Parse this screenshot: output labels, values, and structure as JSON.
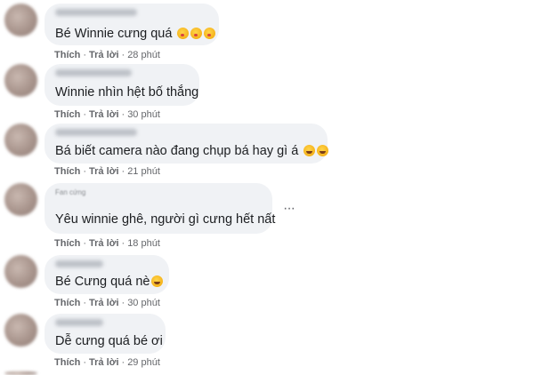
{
  "comments": [
    {
      "text": "Bé Winnie cưng quá",
      "emoji": [
        "kiss-emoji",
        "kiss-emoji",
        "kiss-emoji"
      ],
      "like": "Thích",
      "reply": "Trả lời",
      "time": "28 phút"
    },
    {
      "text": "Winnie nhìn hệt bố thắng",
      "emoji": [],
      "like": "Thích",
      "reply": "Trả lời",
      "time": "30 phút"
    },
    {
      "text": "Bá biết camera nào đang chụp bá hay gì á",
      "emoji": [
        "laugh-emoji",
        "laugh-emoji"
      ],
      "like": "Thích",
      "reply": "Trả lời",
      "time": "21 phút"
    },
    {
      "text": "Yêu winnie ghê, người gì cưng hết nất",
      "badge": "Fan cứng",
      "emoji": [],
      "like": "Thích",
      "reply": "Trả lời",
      "time": "18 phút"
    },
    {
      "text": "Bé Cưng quá nè",
      "emoji": [
        "grin-emoji"
      ],
      "like": "Thích",
      "reply": "Trả lời",
      "time": "30 phút"
    },
    {
      "text": "Dễ cưng quá bé ơi",
      "emoji": [],
      "like": "Thích",
      "reply": "Trả lời",
      "time": "29 phút"
    }
  ],
  "more_options": "···"
}
